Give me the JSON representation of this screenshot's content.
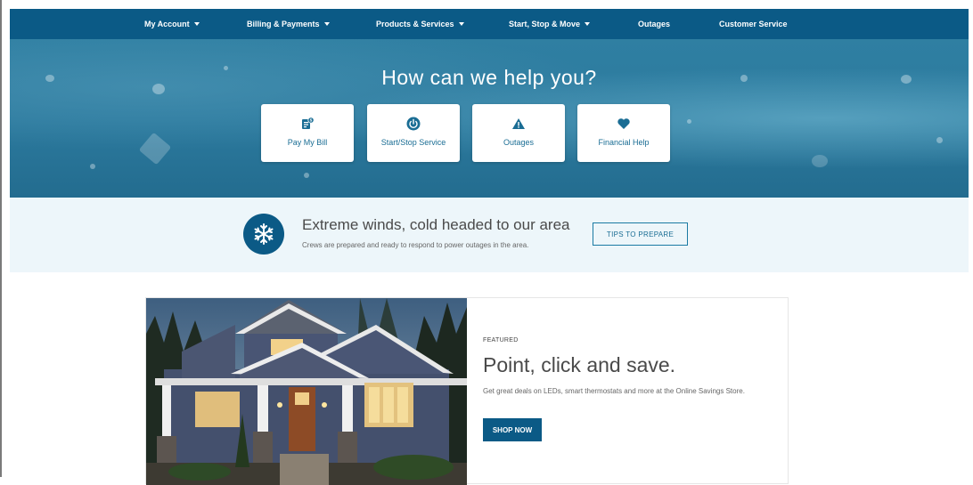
{
  "nav": {
    "items": [
      {
        "label": "My Account",
        "has_dropdown": true
      },
      {
        "label": "Billing & Payments",
        "has_dropdown": true
      },
      {
        "label": "Products & Services",
        "has_dropdown": true
      },
      {
        "label": "Start, Stop & Move",
        "has_dropdown": true
      },
      {
        "label": "Outages",
        "has_dropdown": false
      },
      {
        "label": "Customer Service",
        "has_dropdown": false
      }
    ]
  },
  "hero": {
    "title": "How can we help you?",
    "cards": [
      {
        "label": "Pay My Bill",
        "icon": "bill-icon"
      },
      {
        "label": "Start/Stop Service",
        "icon": "power-icon"
      },
      {
        "label": "Outages",
        "icon": "warning-icon"
      },
      {
        "label": "Financial Help",
        "icon": "heart-icon"
      }
    ]
  },
  "alert": {
    "icon": "snowflake-icon",
    "title": "Extreme winds, cold headed to our area",
    "subtitle": "Crews are prepared and ready to respond to power outages in the area.",
    "button": "TIPS TO PREPARE"
  },
  "feature": {
    "eyebrow": "FEATURED",
    "title": "Point, click and save.",
    "description": "Get great deals on LEDs, smart thermostats and more at the Online Savings Store.",
    "button": "SHOP NOW"
  },
  "colors": {
    "nav": "#0b5a86",
    "hero": "#2c7a9e",
    "accent": "#1a6d94",
    "alert_bg": "#edf6fa"
  }
}
